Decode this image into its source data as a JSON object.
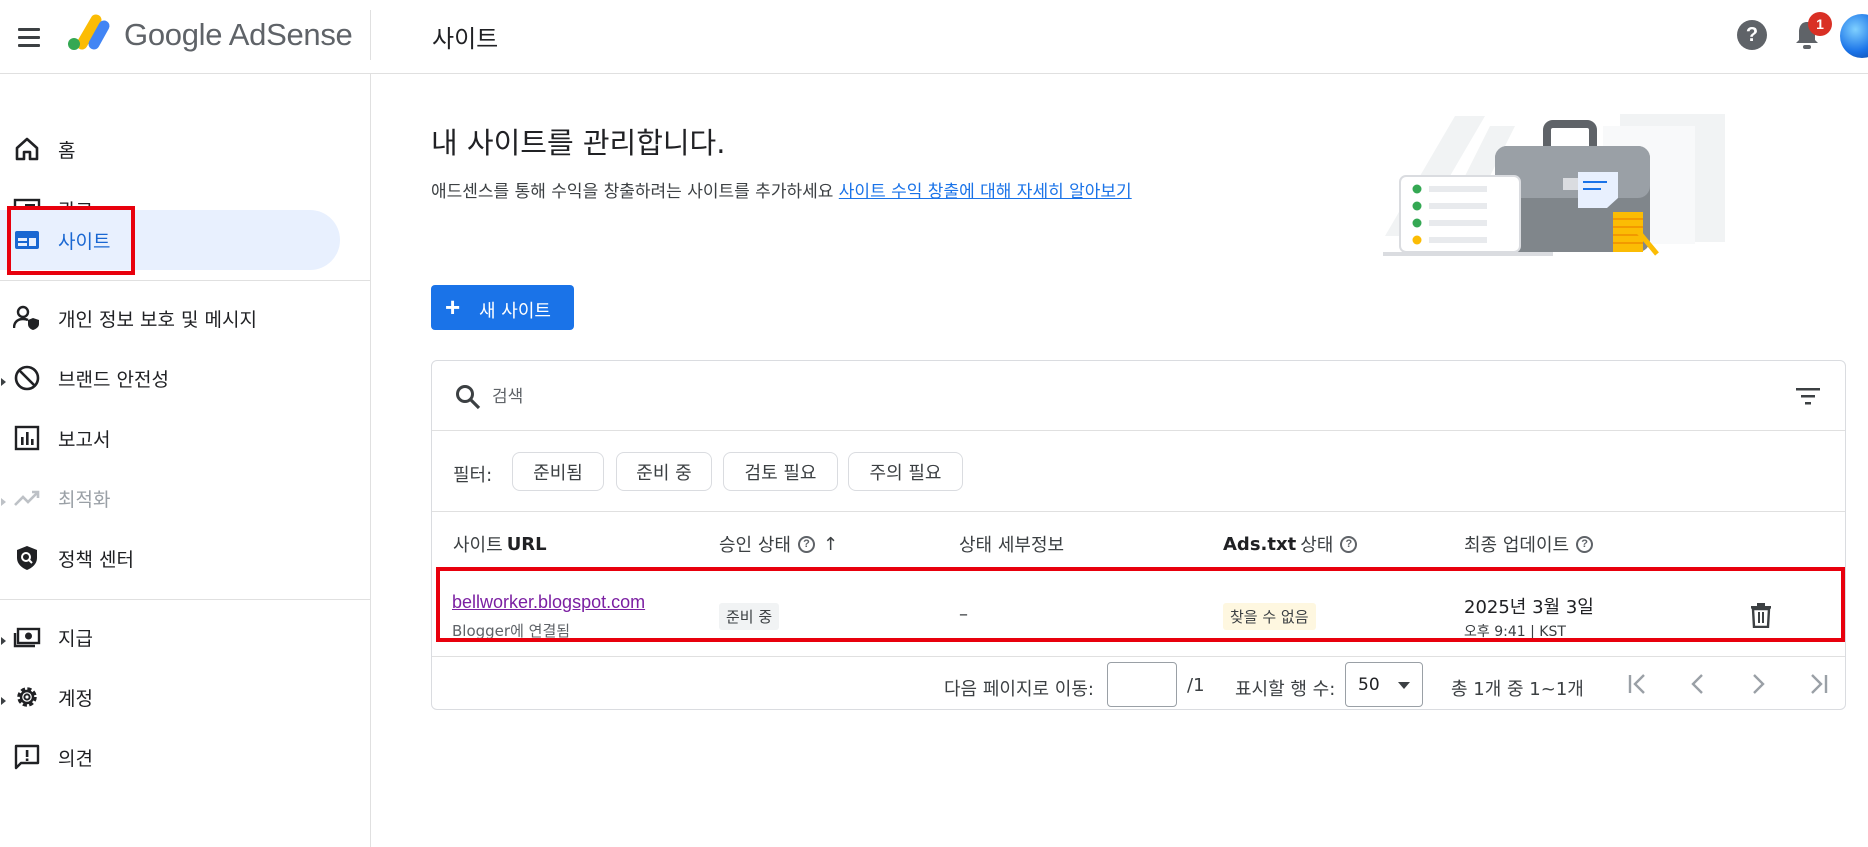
{
  "header": {
    "brand": "Google AdSense",
    "page_title": "사이트",
    "help_icon": "help-icon",
    "notification_count": "1"
  },
  "sidebar": {
    "items": [
      {
        "label": "홈",
        "icon": "home-icon"
      },
      {
        "label": "광고",
        "icon": "ads-icon"
      },
      {
        "label": "사이트",
        "icon": "sites-icon",
        "active": true
      },
      {
        "label": "개인 정보 보호 및 메시지",
        "icon": "privacy-person-icon"
      },
      {
        "label": "브랜드 안전성",
        "icon": "block-icon"
      },
      {
        "label": "보고서",
        "icon": "bar-chart-icon"
      },
      {
        "label": "최적화",
        "icon": "trending-up-icon",
        "disabled": true
      },
      {
        "label": "정책 센터",
        "icon": "policy-shield-icon"
      },
      {
        "label": "지급",
        "icon": "payments-icon"
      },
      {
        "label": "계정",
        "icon": "gear-icon"
      },
      {
        "label": "의견",
        "icon": "feedback-icon"
      }
    ]
  },
  "main": {
    "title": "내 사이트를 관리합니다.",
    "description": "애드센스를 통해 수익을 창출하려는 사이트를 추가하세요",
    "learn_more_link": "사이트 수익 창출에 대해 자세히 알아보기",
    "new_site_button": "새 사이트",
    "search": {
      "placeholder": "검색"
    },
    "filter_label": "필터:",
    "filters": [
      "준비됨",
      "준비 중",
      "검토 필요",
      "주의 필요"
    ],
    "table": {
      "columns": {
        "site_url_prefix": "사이트",
        "site_url_bold": "URL",
        "approval": "승인 상태",
        "status_detail": "상태 세부정보",
        "ads_txt_bold": "Ads.txt",
        "ads_txt_suffix": "상태",
        "last_update": "최종 업데이트"
      },
      "rows": [
        {
          "site": "bellworker.blogspot.com",
          "sub": "Blogger에 연결됨",
          "approval": "준비 중",
          "detail": "–",
          "ads_txt": "찾을 수 없음",
          "date": "2025년 3월 3일",
          "time": "오후 9:41 | KST"
        }
      ]
    },
    "pager": {
      "goto_label": "다음 페이지로 이동:",
      "page_value": "",
      "total_pages": "/1",
      "rows_label": "표시할 행 수:",
      "rows_value": "50",
      "range_text": "총 1개 중 1~1개"
    }
  },
  "colors": {
    "accent": "#1a73e8",
    "active_bg": "#e8f0fe",
    "highlight": "#e8000d"
  }
}
